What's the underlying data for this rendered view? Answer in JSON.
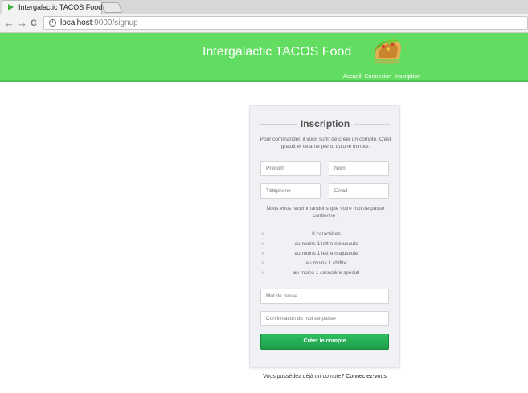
{
  "browser": {
    "tab_title": "Intergalactic TACOS Food",
    "tab_close": "×",
    "nav_back": "←",
    "nav_forward": "→",
    "nav_reload": "C",
    "url_host": "localhost",
    "url_rest": ":9000/signup"
  },
  "site": {
    "brand": "Intergalactic TACOS Food",
    "nav": [
      "Accueil",
      "Connexion",
      "Inscription"
    ],
    "colors": {
      "header": "#62dd62",
      "button": "#25ad53"
    }
  },
  "signup": {
    "title": "Inscription",
    "intro": "Pour commander, il vous suffit de créer un compte. C'est gratuit et cela ne prend qu'une minute.",
    "placeholders": {
      "firstname": "Prénom",
      "lastname": "Nom",
      "phone": "Téléphone",
      "email": "Email",
      "password": "Mot de passe",
      "password_confirm": "Confirmation du mot de passe"
    },
    "recommend": "Nous vous recommandons que votre mot de passe contienne :",
    "rules": [
      "8 caractères",
      "au moins 1 lettre minuscule",
      "au moins 1 lettre majuscule",
      "au moins 1 chiffre",
      "au moins 1 caractère spécial"
    ],
    "rule_marker": "»",
    "submit": "Créer le compte"
  },
  "footer": {
    "question": "Vous possédez déjà un compte?",
    "login_link": "Connectez-vous"
  }
}
